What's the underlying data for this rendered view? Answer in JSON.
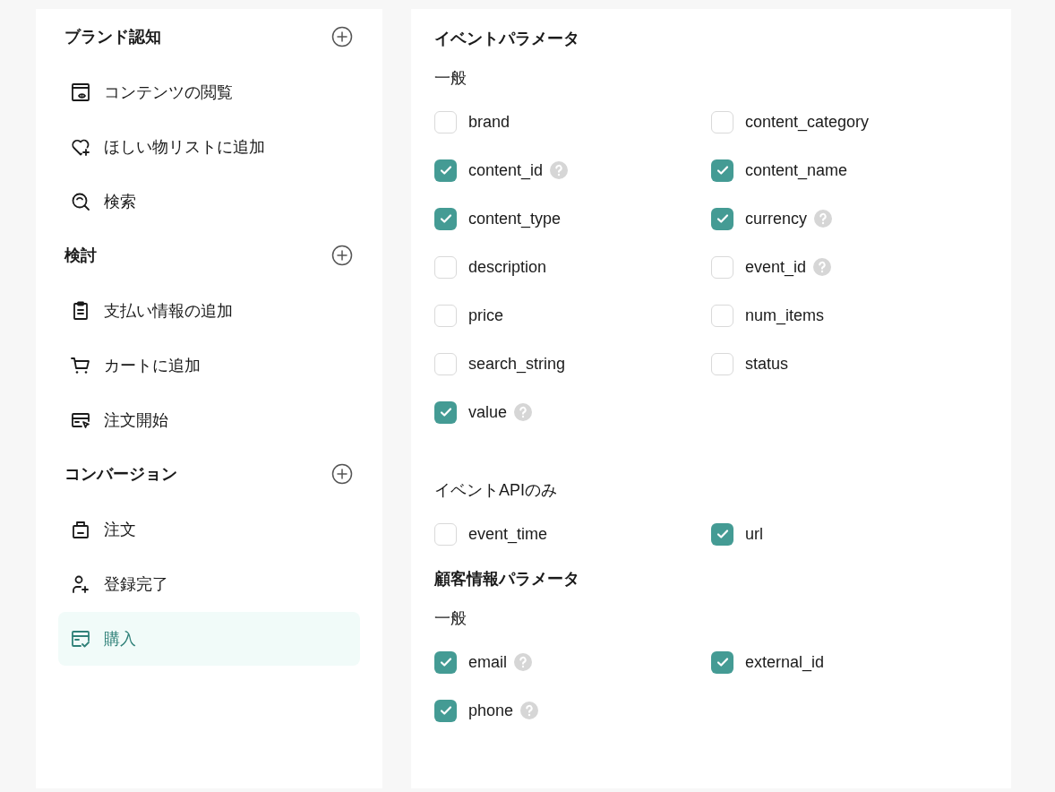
{
  "sidebar": {
    "sections": [
      {
        "title": "ブランド認知",
        "items": [
          {
            "label": "コンテンツの閲覧",
            "selected": false
          },
          {
            "label": "ほしい物リストに追加",
            "selected": false
          },
          {
            "label": "検索",
            "selected": false
          }
        ]
      },
      {
        "title": "検討",
        "items": [
          {
            "label": "支払い情報の追加",
            "selected": false
          },
          {
            "label": "カートに追加",
            "selected": false
          },
          {
            "label": "注文開始",
            "selected": false
          }
        ]
      },
      {
        "title": "コンバージョン",
        "items": [
          {
            "label": "注文",
            "selected": false
          },
          {
            "label": "登録完了",
            "selected": false
          },
          {
            "label": "購入",
            "selected": true
          }
        ]
      }
    ]
  },
  "parameters": [
    {
      "title": "イベントパラメータ",
      "groups": [
        {
          "title": "一般",
          "fields": [
            {
              "label": "brand",
              "checked": false,
              "help": false
            },
            {
              "label": "content_category",
              "checked": false,
              "help": false
            },
            {
              "label": "content_id",
              "checked": true,
              "help": true
            },
            {
              "label": "content_name",
              "checked": true,
              "help": false
            },
            {
              "label": "content_type",
              "checked": true,
              "help": false
            },
            {
              "label": "currency",
              "checked": true,
              "help": true
            },
            {
              "label": "description",
              "checked": false,
              "help": false
            },
            {
              "label": "event_id",
              "checked": false,
              "help": true
            },
            {
              "label": "price",
              "checked": false,
              "help": false
            },
            {
              "label": "num_items",
              "checked": false,
              "help": false
            },
            {
              "label": "search_string",
              "checked": false,
              "help": false
            },
            {
              "label": "status",
              "checked": false,
              "help": false
            },
            {
              "label": "value",
              "checked": true,
              "help": true
            }
          ]
        },
        {
          "title": "イベントAPIのみ",
          "fields": [
            {
              "label": "event_time",
              "checked": false,
              "help": false
            },
            {
              "label": "url",
              "checked": true,
              "help": false
            }
          ]
        }
      ]
    },
    {
      "title": "顧客情報パラメータ",
      "groups": [
        {
          "title": "一般",
          "fields": [
            {
              "label": "email",
              "checked": true,
              "help": true
            },
            {
              "label": "external_id",
              "checked": true,
              "help": false
            },
            {
              "label": "phone",
              "checked": true,
              "help": true
            }
          ]
        }
      ]
    }
  ]
}
